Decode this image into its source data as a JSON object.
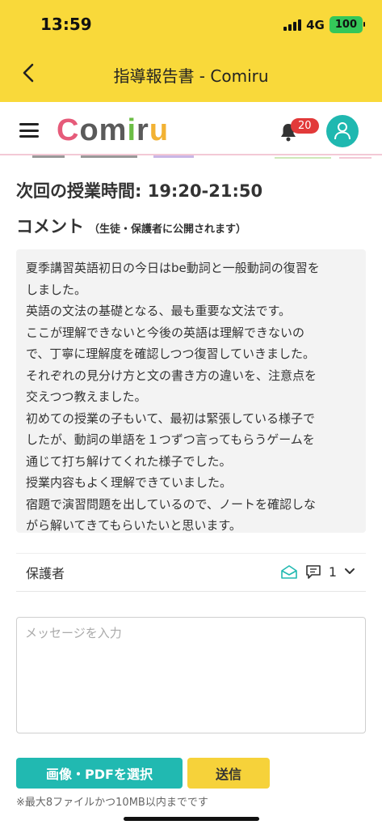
{
  "status_bar": {
    "time": "13:59",
    "network": "4G",
    "battery": "100"
  },
  "nav": {
    "title": "指導報告書 - Comiru"
  },
  "header": {
    "logo": {
      "c": "C",
      "o": "o",
      "m": "m",
      "i": "i",
      "r": "r",
      "u": "u"
    },
    "notification_count": "20"
  },
  "report": {
    "next_class_time": "次回の授業時間: 19:20-21:50",
    "comment_title": "コメント",
    "comment_note": "（生徒・保護者に公開されます）",
    "comment_lines": [
      "夏季講習英語初日の今日はbe動詞と一般動詞の復習を",
      "しました。",
      "英語の文法の基礎となる、最も重要な文法です。",
      "ここが理解できないと今後の英語は理解できないの",
      "で、丁寧に理解度を確認しつつ復習していきました。",
      "それぞれの見分け方と文の書き方の違いを、注意点を",
      "交えつつ教えました。",
      "初めての授業の子もいて、最初は緊張している様子で",
      "したが、動詞の単語を１つずつ言ってもらうゲームを",
      "通じて打ち解けてくれた様子でした。",
      "授業内容もよく理解できていました。",
      "宿題で演習問題を出しているので、ノートを確認しな",
      "がら解いてきてもらいたいと思います。"
    ]
  },
  "guardian": {
    "label": "保護者",
    "comment_count": "1"
  },
  "message": {
    "placeholder": "メッセージを入力"
  },
  "actions": {
    "file_select_label": "画像・PDFを選択",
    "send_label": "送信",
    "file_note": "※最大8ファイルかつ10MB以内までです"
  },
  "colors": {
    "top_bar": "#F9D93A",
    "teal": "#21B9B1",
    "badge_red": "#E23A3A",
    "logo_pink": "#E65B7A"
  }
}
